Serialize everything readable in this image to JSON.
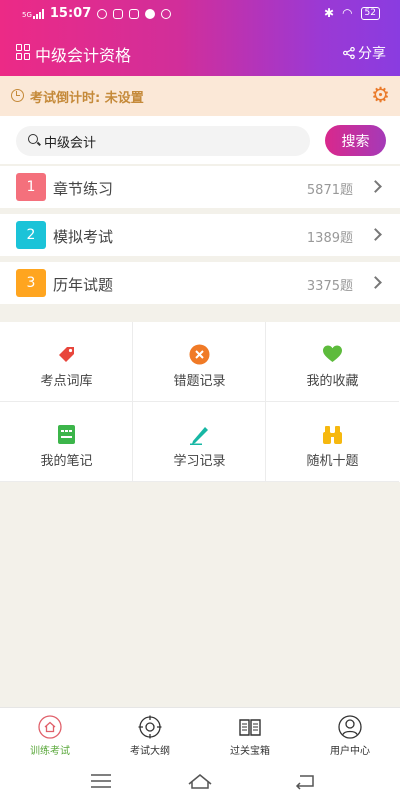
{
  "status": {
    "network": "5G",
    "time": "15:07",
    "battery": "52"
  },
  "header": {
    "title": "中级会计资格",
    "share_label": "分享",
    "colors": {
      "gradient_start": "#ec2a86",
      "gradient_end": "#8a3ce0"
    }
  },
  "countdown": {
    "text": "考试倒计时: 未设置",
    "color": "#c58a3a"
  },
  "search": {
    "value": "中级会计",
    "button_label": "搜索"
  },
  "categories": [
    {
      "num": "1",
      "name": "章节练习",
      "count": "5871题",
      "color": "#f4707c"
    },
    {
      "num": "2",
      "name": "模拟考试",
      "count": "1389题",
      "color": "#1bc3d8"
    },
    {
      "num": "3",
      "name": "历年试题",
      "count": "3375题",
      "color": "#ffa51f"
    }
  ],
  "tools": [
    {
      "label": "考点词库",
      "icon": "tag-icon",
      "color": "#e8463c"
    },
    {
      "label": "错题记录",
      "icon": "cross-circle-icon",
      "color": "#f07a26"
    },
    {
      "label": "我的收藏",
      "icon": "heart-icon",
      "color": "#5dbb3c"
    },
    {
      "label": "我的笔记",
      "icon": "notebook-icon",
      "color": "#3cb54a"
    },
    {
      "label": "学习记录",
      "icon": "pencil-icon",
      "color": "#17b7a4"
    },
    {
      "label": "随机十题",
      "icon": "binoculars-icon",
      "color": "#f6b80f"
    }
  ],
  "tabs": [
    {
      "label": "训练考试",
      "icon": "home-icon",
      "active": true
    },
    {
      "label": "考试大纲",
      "icon": "target-icon",
      "active": false
    },
    {
      "label": "过关宝箱",
      "icon": "book-icon",
      "active": false
    },
    {
      "label": "用户中心",
      "icon": "user-icon",
      "active": false
    }
  ],
  "active_tab_color": "#5aa83b"
}
